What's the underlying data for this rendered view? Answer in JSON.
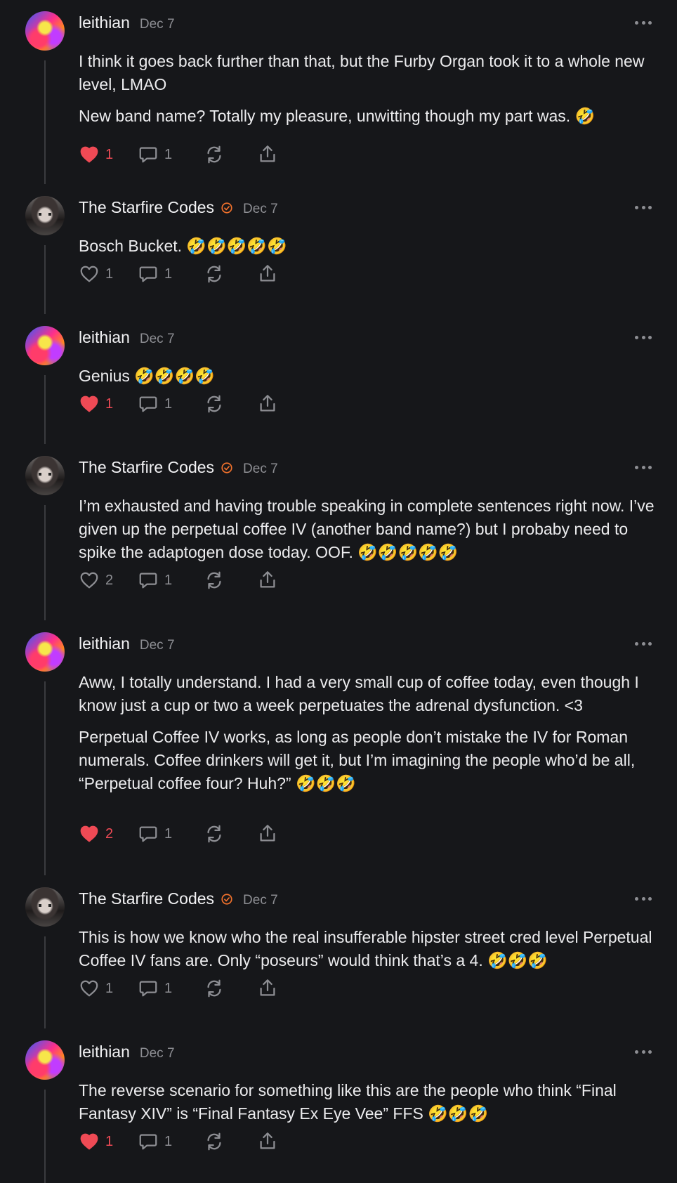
{
  "colors": {
    "background": "#16171a",
    "text": "#ececee",
    "muted": "#8d8e93",
    "like_active": "#ef4a55",
    "verified_badge": "#f0712c",
    "thread_line": "#3a3b3f"
  },
  "comments": [
    {
      "author": "leithian",
      "verified": false,
      "date": "Dec 7",
      "paragraphs": [
        "I think it goes back further than that, but the Furby Organ took it to a whole new level, LMAO",
        "New band name? Totally my pleasure, unwitting though my part was. 🤣"
      ],
      "likes": "1",
      "liked": true,
      "replies": "1"
    },
    {
      "author": "The Starfire Codes",
      "verified": true,
      "date": "Dec 7",
      "paragraphs": [
        "Bosch Bucket. 🤣🤣🤣🤣🤣"
      ],
      "likes": "1",
      "liked": false,
      "replies": "1"
    },
    {
      "author": "leithian",
      "verified": false,
      "date": "Dec 7",
      "paragraphs": [
        "Genius 🤣🤣🤣🤣"
      ],
      "likes": "1",
      "liked": true,
      "replies": "1"
    },
    {
      "author": "The Starfire Codes",
      "verified": true,
      "date": "Dec 7",
      "paragraphs": [
        "I’m exhausted and having trouble speaking in complete sentences right now. I’ve given up the perpetual coffee IV (another band name?) but I probaby need to spike the adaptogen dose today. OOF. 🤣🤣🤣🤣🤣"
      ],
      "likes": "2",
      "liked": false,
      "replies": "1"
    },
    {
      "author": "leithian",
      "verified": false,
      "date": "Dec 7",
      "paragraphs": [
        "Aww, I totally understand. I had a very small cup of coffee today, even though I know just a cup or two a week perpetuates the adrenal dysfunction. <3",
        "Perpetual Coffee IV works, as long as people don’t mistake the IV for Roman numerals. Coffee drinkers will get it, but I’m imagining the people who’d be all, “Perpetual coffee four? Huh?” 🤣🤣🤣"
      ],
      "likes": "2",
      "liked": true,
      "replies": "1"
    },
    {
      "author": "The Starfire Codes",
      "verified": true,
      "date": "Dec 7",
      "paragraphs": [
        "This is how we know who the real insufferable hipster street cred level Perpetual Coffee IV fans are. Only “poseurs” would think that’s a 4. 🤣🤣🤣"
      ],
      "likes": "1",
      "liked": false,
      "replies": "1"
    },
    {
      "author": "leithian",
      "verified": false,
      "date": "Dec 7",
      "paragraphs": [
        "The reverse scenario for something like this are the people who think “Final Fantasy XIV” is “Final Fantasy Ex Eye Vee” FFS 🤣🤣🤣"
      ],
      "likes": "1",
      "liked": true,
      "replies": "1"
    }
  ]
}
